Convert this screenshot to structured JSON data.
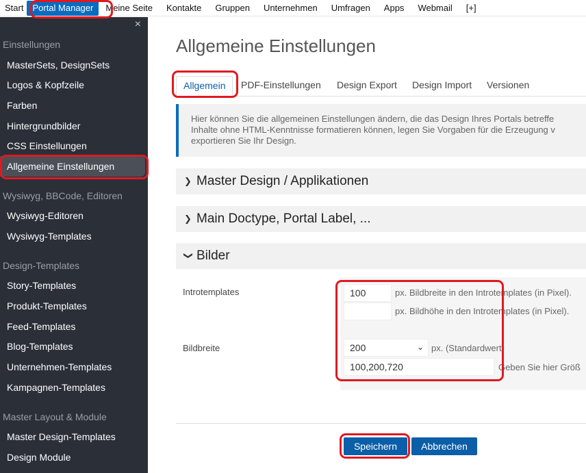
{
  "topnav": {
    "items": [
      "Start",
      "Portal Manager",
      "Meine Seite",
      "Kontakte",
      "Gruppen",
      "Unternehmen",
      "Umfragen",
      "Apps",
      "Webmail",
      "[+]"
    ]
  },
  "sidebar": {
    "close": "×",
    "sections": {
      "einstellungen": "Einstellungen",
      "wysiwyg": "Wysiwyg, BBCode, Editoren",
      "design_templates": "Design-Templates",
      "master_layout": "Master Layout & Module"
    },
    "links": {
      "mastersets": "MasterSets, DesignSets",
      "logos": "Logos & Kopfzeile",
      "farben": "Farben",
      "hintergrund": "Hintergrundbilder",
      "css": "CSS Einstellungen",
      "allgemeine": "Allgemeine Einstellungen",
      "wysiwyg_editoren": "Wysiwyg-Editoren",
      "wysiwyg_templates": "Wysiwyg-Templates",
      "story": "Story-Templates",
      "produkt": "Produkt-Templates",
      "feed": "Feed-Templates",
      "blog": "Blog-Templates",
      "unternehmen": "Unternehmen-Templates",
      "kampagnen": "Kampagnen-Templates",
      "master_design": "Master Design-Templates",
      "design_module": "Design Module"
    }
  },
  "main": {
    "title": "Allgemeine Einstellungen",
    "tabs": [
      "Allgemein",
      "PDF-Einstellungen",
      "Design Export",
      "Design Import",
      "Versionen"
    ],
    "info": {
      "line1": "Hier können Sie die allgemeinen Einstellungen ändern, die das Design Ihres Portals betreffe",
      "line2": "Inhalte ohne HTML-Kenntnisse formatieren können, legen Sie Vorgaben für die Erzeugung v",
      "line3": "exportieren Sie Ihr Design."
    },
    "accordions": {
      "master": "Master Design / Applikationen",
      "doctype": "Main Doctype, Portal Label, ...",
      "bilder": "Bilder"
    },
    "form": {
      "introtemplates_label": "Introtemplates",
      "bildbreite_value": "100",
      "bildbreite_suffix": "px. Bildbreite in den Introtemplates (in Pixel).",
      "bildhoehe_value": "",
      "bildhoehe_suffix": "px. Bildhöhe in den Introtemplates (in Pixel).",
      "bildbreite_label": "Bildbreite",
      "standard_value": "200",
      "standard_suffix": "px. (Standardwert)",
      "groessen_value": "100,200,720",
      "groessen_suffix": "Geben Sie hier Größ"
    },
    "buttons": {
      "save": "Speichern",
      "cancel": "Abbrechen"
    }
  },
  "colors": {
    "accent": "#0b6bbf",
    "sidebar_bg": "#2b2f38",
    "annotation": "#e0191f"
  }
}
